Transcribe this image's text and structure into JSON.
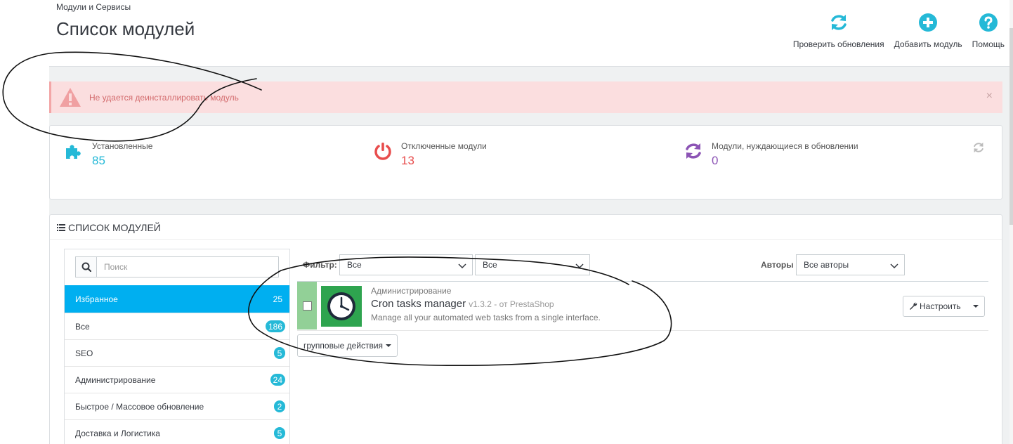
{
  "header": {
    "breadcrumb": "Модули и Сервисы",
    "title": "Список модулей",
    "toolbar": [
      {
        "label": "Проверить обновления",
        "icon": "refresh-icon"
      },
      {
        "label": "Добавить модуль",
        "icon": "plus-circle-icon"
      },
      {
        "label": "Помощь",
        "icon": "help-icon"
      }
    ]
  },
  "alert": {
    "text": "Не удается деинсталлировать модуль",
    "close": "×"
  },
  "stats": [
    {
      "label": "Установленные",
      "value": "85",
      "color": "#25b9d7",
      "icon": "puzzle-icon"
    },
    {
      "label": "Отключенные модули",
      "value": "13",
      "color": "#e84d4d",
      "icon": "power-icon"
    },
    {
      "label": "Модули, нуждающиеся в обновлении",
      "value": "0",
      "color": "#8c54b5",
      "icon": "refresh-icon"
    }
  ],
  "list": {
    "heading": "СПИСОК МОДУЛЕЙ",
    "search_placeholder": "Поиск",
    "categories": [
      {
        "label": "Избранное",
        "count": "25",
        "active": true
      },
      {
        "label": "Все",
        "count": "186"
      },
      {
        "label": "SEO",
        "count": "5"
      },
      {
        "label": "Администрирование",
        "count": "24"
      },
      {
        "label": "Быстрое / Массовое обновление",
        "count": "2"
      },
      {
        "label": "Доставка и Логистика",
        "count": "5"
      }
    ],
    "filter_label": "Фильтр:",
    "filter1": "Все",
    "filter2": "Все",
    "authors_label": "Авторы",
    "authors_value": "Все авторы",
    "module": {
      "category": "Администрирование",
      "name": "Cron tasks manager",
      "version": "v1.3.2 - от PrestaShop",
      "description": "Manage all your automated web tasks from a single interface.",
      "configure_label": "Настроить"
    },
    "bulk_label": "групповые действия"
  },
  "colors": {
    "accent": "#00aff0",
    "badge": "#25b9d7",
    "alert_bg": "#fbdedf",
    "module_status": "#92d097"
  }
}
